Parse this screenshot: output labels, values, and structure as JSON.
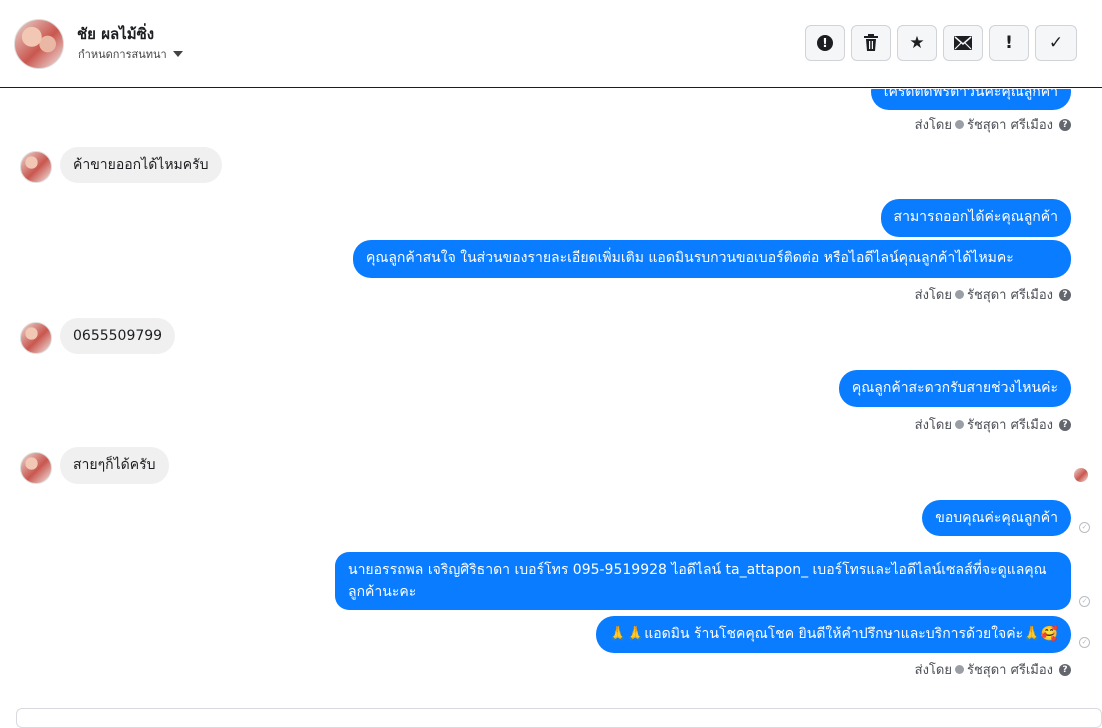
{
  "header": {
    "contact_name": "ชัย ผลไม้ซิ่ง",
    "assign_label": "กำหนดการสนทนา"
  },
  "toolbar": {
    "buttons": [
      {
        "name": "spam",
        "icon": "alert-circle-icon",
        "glyph": "!"
      },
      {
        "name": "delete",
        "icon": "trash-icon",
        "glyph": "🗑"
      },
      {
        "name": "star",
        "icon": "star-icon",
        "glyph": "★"
      },
      {
        "name": "unread",
        "icon": "envelope-icon",
        "glyph": "✉"
      },
      {
        "name": "follow-up",
        "icon": "exclamation-icon",
        "glyph": "!"
      },
      {
        "name": "done",
        "icon": "check-icon",
        "glyph": "✓"
      }
    ]
  },
  "messages": [
    {
      "side": "out",
      "text": "เครดิตดีฟรีตำวันคะคุณลูกค้า"
    },
    {
      "side": "in",
      "text": "ค้าขายออกได้ไหมครับ"
    },
    {
      "side": "out",
      "text": "สามารถออกได้ค่ะคุณลูกค้า"
    },
    {
      "side": "out",
      "text": "คุณลูกค้าสนใจ ในส่วนของรายละเอียดเพิ่มเติม แอดมินรบกวนขอเบอร์ติดต่อ หรือไอดีไลน์คุณลูกค้าได้ไหมคะ"
    },
    {
      "side": "in",
      "text": "0655509799"
    },
    {
      "side": "out",
      "text": "คุณลูกค้าสะดวกรับสายช่วงไหนค่ะ"
    },
    {
      "side": "in",
      "text": "สายๆก็ได้ครับ"
    },
    {
      "side": "out",
      "text": "ขอบคุณค่ะคุณลูกค้า"
    },
    {
      "side": "out",
      "text": "นายอรรถพล เจริญศิริธาดา     เบอร์โทร 095-9519928 ไอดีไลน์ ta_attapon_   เบอร์โทรและไอดีไลน์เซลส์ที่จะดูแลคุณลูกค้านะคะ"
    },
    {
      "side": "out",
      "text": "🙏🙏แอดมิน ร้านโชคคุณโชค ยินดีให้คำปรึกษาและบริการด้วยใจค่ะ🙏🥰"
    }
  ],
  "sent_by": {
    "prefix": "ส่งโดย",
    "agent": "รัชสุดา ศรีเมือง"
  }
}
